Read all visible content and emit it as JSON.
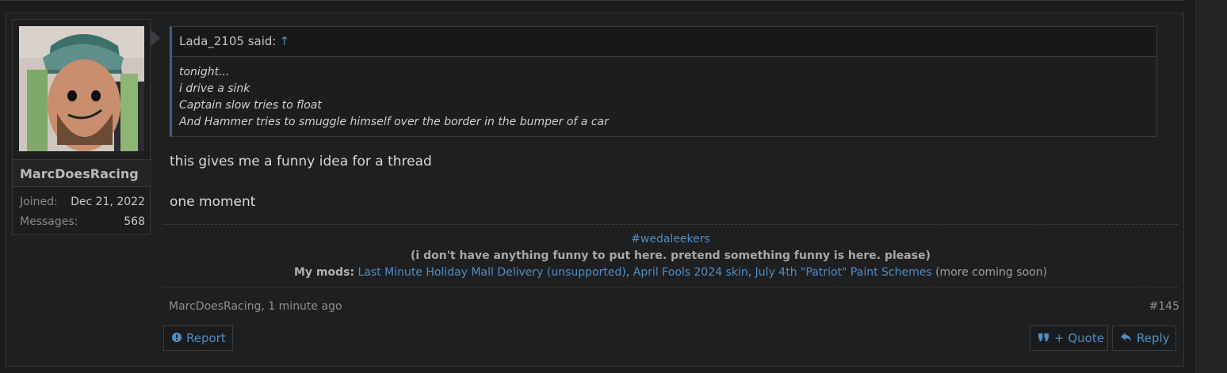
{
  "user": {
    "name": "MarcDoesRacing",
    "joined_label": "Joined:",
    "joined_value": "Dec 21, 2022",
    "messages_label": "Messages:",
    "messages_value": "568"
  },
  "quote": {
    "author_said": "Lada_2105 said:",
    "jump_icon": "↑",
    "lines": [
      "tonight...",
      "i drive a sink",
      "Captain slow tries to float",
      "And Hammer tries to smuggle himself over the border in the bumper of a car"
    ]
  },
  "message": {
    "line1": "this gives me a funny idea for a thread",
    "line2": "one moment"
  },
  "signature": {
    "tag": "#wedaleekers",
    "bold_text": "(i don't have anything funny to put here. pretend something funny is here. please)",
    "mods_label": "My mods:",
    "mod1": "Last Minute Holiday Mall Delivery (unsupported)",
    "mod2": "April Fools 2024 skin",
    "mod3": "July 4th \"Patriot\" Paint Schemes",
    "sep": ",",
    "more": "(more coming soon)"
  },
  "footer": {
    "meta": "MarcDoesRacing, 1 minute ago",
    "post_number": "#145",
    "report_label": "Report",
    "quote_label": "+ Quote",
    "reply_label": "Reply"
  },
  "icons": {
    "report": "alert-circle-icon",
    "quote": "quote-icon",
    "reply": "reply-icon"
  },
  "colors": {
    "link": "#4e8fc5",
    "background": "#1b1c1e"
  }
}
